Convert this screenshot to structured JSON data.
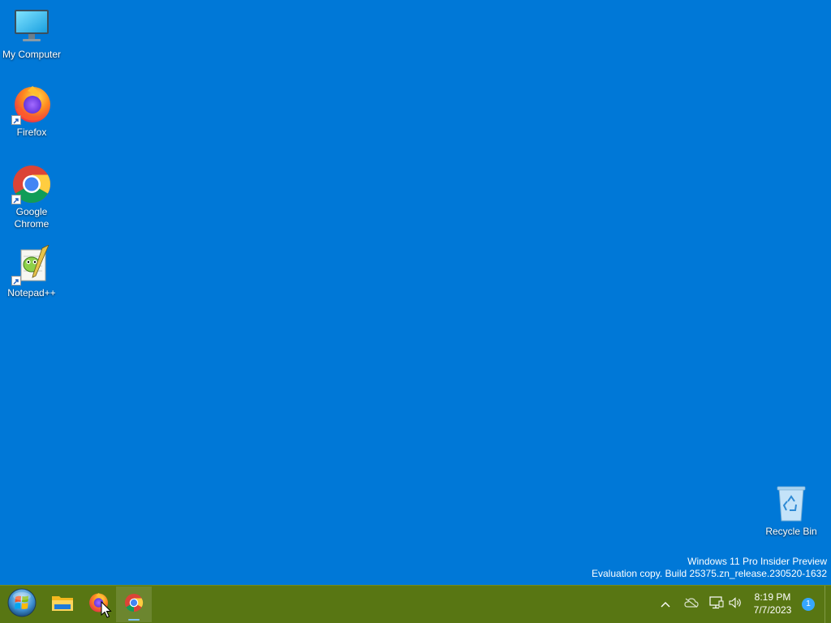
{
  "desktop": {
    "background": "#0078d7",
    "icons": [
      {
        "label": "My Computer",
        "icon": "monitor-icon"
      },
      {
        "label": "Firefox",
        "icon": "firefox-icon"
      },
      {
        "label": "Google Chrome",
        "icon": "chrome-icon"
      },
      {
        "label": "Notepad++",
        "icon": "notepadpp-icon"
      },
      {
        "label": "Recycle Bin",
        "icon": "recycle-bin-icon"
      }
    ]
  },
  "watermark": {
    "line1": "Windows 11 Pro Insider Preview",
    "line2": "Evaluation copy. Build 25375.zn_release.230520-1632"
  },
  "taskbar": {
    "color": "#587613",
    "start_icon": "windows-orb-icon",
    "pinned": [
      {
        "name": "File Explorer",
        "icon": "folder-icon",
        "active": false
      },
      {
        "name": "Firefox",
        "icon": "firefox-icon",
        "active": false
      },
      {
        "name": "Google Chrome",
        "icon": "chrome-icon",
        "active": true
      }
    ],
    "tray": {
      "icons": [
        "chevron-up-icon",
        "onedrive-offline-icon",
        "network-icon",
        "volume-icon"
      ],
      "time": "8:19 PM",
      "date": "7/7/2023",
      "notification_count": "1"
    }
  }
}
